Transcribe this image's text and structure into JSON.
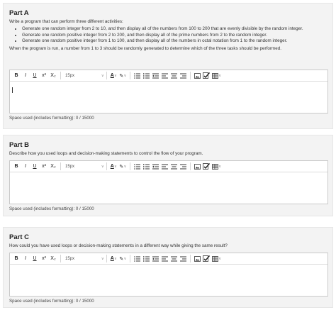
{
  "parts": [
    {
      "title": "Part A",
      "intro": "Write a program that can perform three different activities:",
      "bullets": [
        "Generate one random integer from 2 to 10, and then display all of the numbers from 100 to 200 that are evenly divisible by the random integer.",
        "Generate one random positive integer from 2 to 200, and then display all of the prime numbers from 2 to the random integer.",
        "Generate one random positive integer from 1 to 100, and then display all of the numbers in octal notation from 1 to the random integer."
      ],
      "outro": "When the program is run, a number from 1 to 3 should be randomly generated to determine which of the three tasks should be performed.",
      "space_used": "Space used (includes formatting): 0 / 15000"
    },
    {
      "title": "Part B",
      "intro": "Describe how you used loops and decision-making statements to control the flow of your program.",
      "space_used": "Space used (includes formatting): 0 / 15000"
    },
    {
      "title": "Part C",
      "intro": "How could you have used loops or decision-making statements in a different way while giving the same result?",
      "space_used": "Space used (includes formatting): 0 / 15000"
    }
  ],
  "toolbar": {
    "bold": "B",
    "italic": "I",
    "underline": "U",
    "superscript": "x²",
    "subscript": "X₂",
    "font_size": "15px",
    "font_color": "A",
    "highlight": "✎",
    "chevron": "v"
  }
}
